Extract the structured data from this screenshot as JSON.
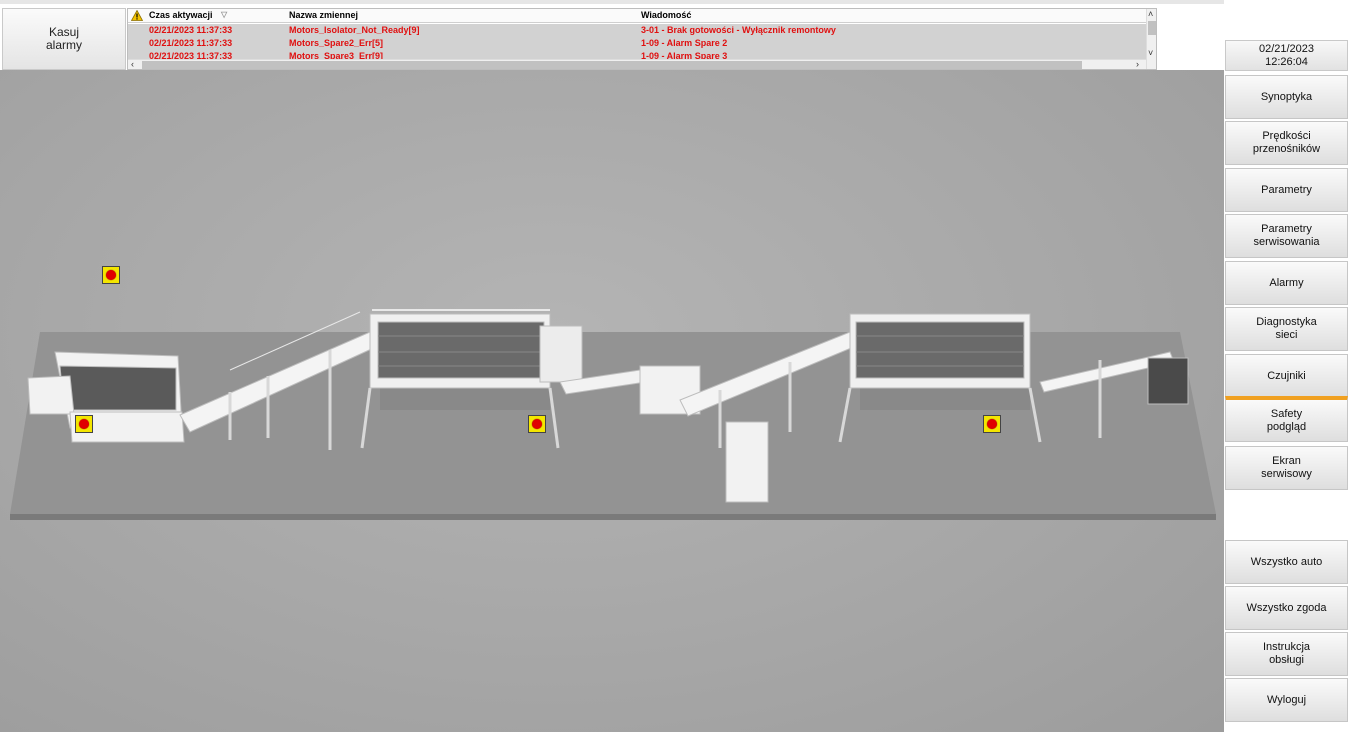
{
  "header": {
    "clear_alarms_label": "Kasuj\nalarmy"
  },
  "alarm_table": {
    "columns": [
      "Czas aktywacji",
      "Nazwa zmiennej",
      "Wiadomość"
    ],
    "rows": [
      {
        "time": "02/21/2023 11:37:33",
        "variable": "Motors_Isolator_Not_Ready[9]",
        "message": "3-01 - Brak gotowości - Wyłącznik remontowy"
      },
      {
        "time": "02/21/2023 11:37:33",
        "variable": "Motors_Spare2_Err[5]",
        "message": "1-09 - Alarm Spare 2"
      },
      {
        "time": "02/21/2023 11:37:33",
        "variable": "Motors_Spare3_Err[9]",
        "message": "1-09 - Alarm Spare 3"
      }
    ],
    "colors": {
      "alarm_text": "#e01010",
      "row_bg": "#d2d2d2"
    }
  },
  "sidebar": {
    "date": "02/21/2023",
    "time": "12:26:04",
    "buttons": [
      {
        "label": "Synoptyka"
      },
      {
        "label": "Prędkości\nprzenośników"
      },
      {
        "label": "Parametry"
      },
      {
        "label": "Parametry\nserwisowania"
      },
      {
        "label": "Alarmy"
      },
      {
        "label": "Diagnostyka\nsieci"
      },
      {
        "label": "Czujniki"
      },
      {
        "label": "Safety\npodgląd"
      },
      {
        "label": "Ekran\nserwisowy"
      },
      {
        "label": "Wszystko auto"
      },
      {
        "label": "Wszystko zgoda"
      },
      {
        "label": "Instrukcja\nobsługi"
      },
      {
        "label": "Wyloguj"
      }
    ],
    "active_accent": "#f0a020"
  },
  "status_indicators": [
    {
      "name": "status-indicator-1",
      "state": "alarm"
    },
    {
      "name": "status-indicator-2",
      "state": "alarm"
    },
    {
      "name": "status-indicator-3",
      "state": "alarm"
    },
    {
      "name": "status-indicator-4",
      "state": "alarm"
    }
  ]
}
